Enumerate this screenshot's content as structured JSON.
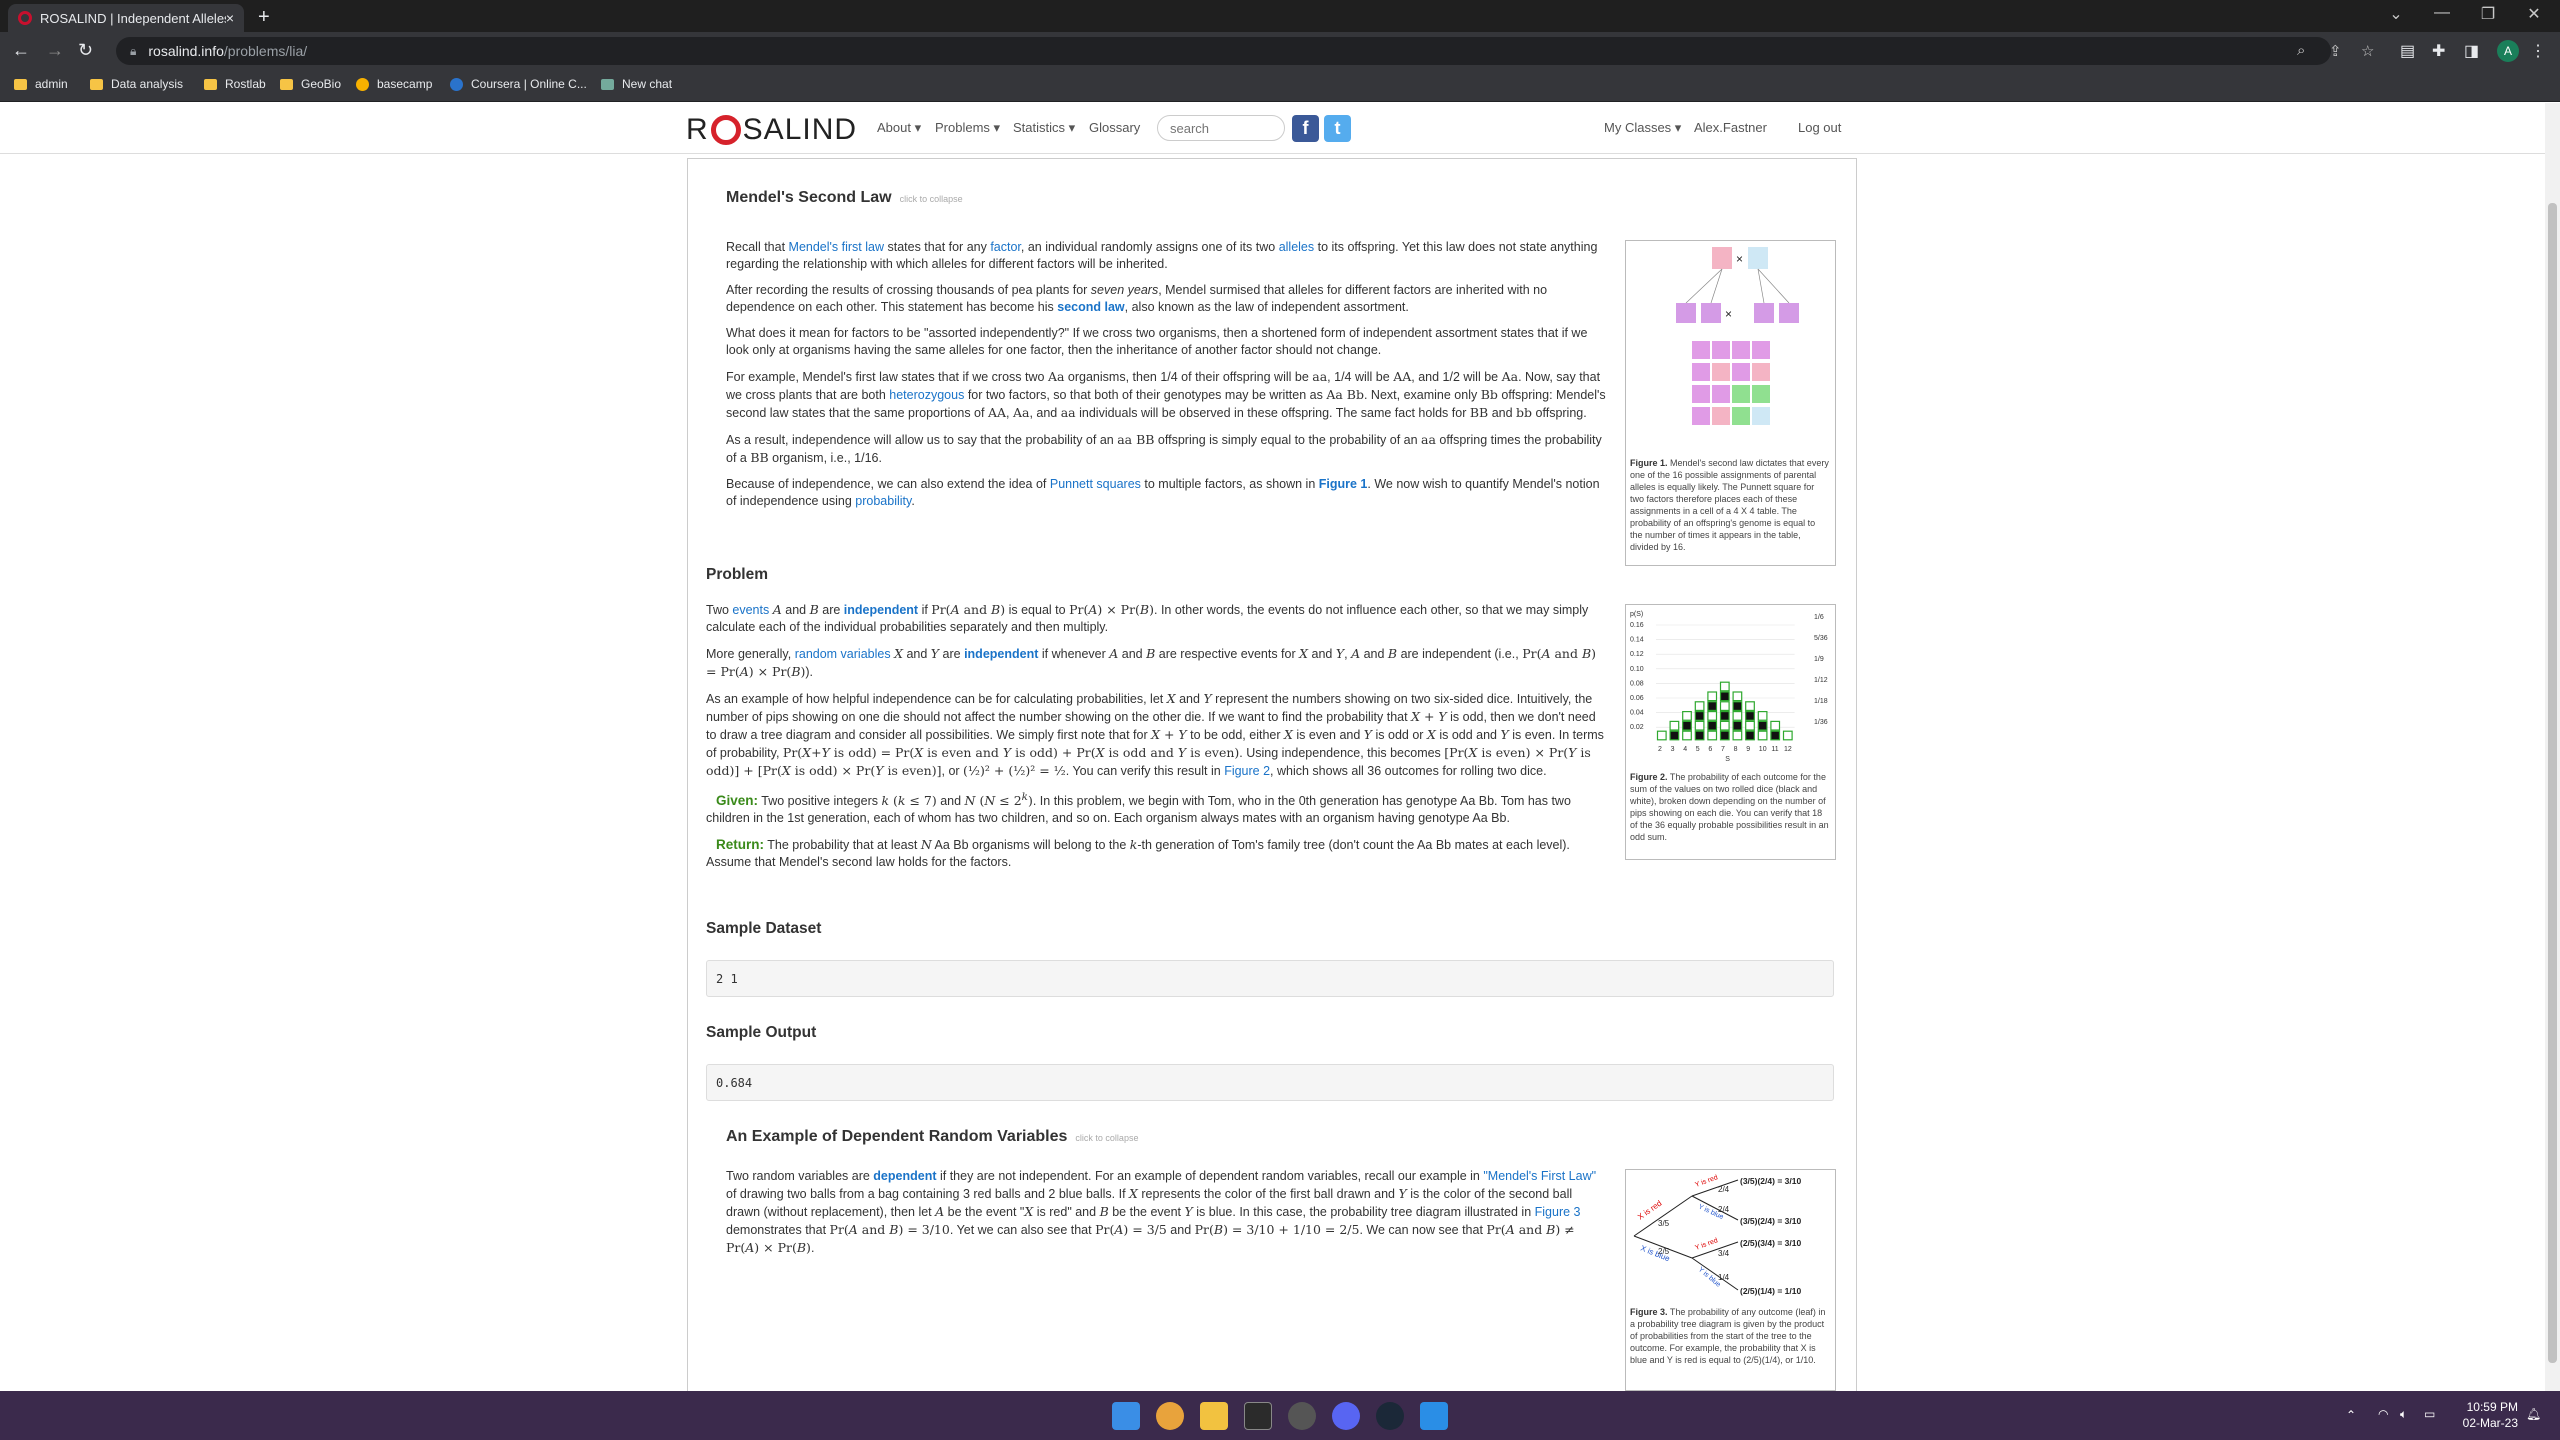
{
  "browser": {
    "tab_title": "ROSALIND | Independent Alleles",
    "tab_close": "×",
    "new_tab": "+",
    "url_host": "rosalind.info",
    "url_path": "/problems/lia/",
    "profile_initial": "A",
    "bookmarks": [
      "admin",
      "Data analysis",
      "Rostlab",
      "GeoBio",
      "basecamp",
      "Coursera | Online C...",
      "New chat"
    ]
  },
  "site": {
    "logo_left": "R",
    "logo_right": "SALIND",
    "nav": [
      "About",
      "Problems",
      "Statistics",
      "Glossary"
    ],
    "search_placeholder": "search",
    "facebook": "f",
    "twitter": "t",
    "my_classes": "My Classes",
    "user": "Alex.Fastner",
    "logout": "Log out"
  },
  "mendel": {
    "title": "Mendel's Second Law",
    "collapse": "click to collapse",
    "p1_a": "Recall that ",
    "p1_link1": "Mendel's first law",
    "p1_b": " states that for any ",
    "p1_link2": "factor",
    "p1_c": ", an individual randomly assigns one of its two ",
    "p1_link3": "alleles",
    "p1_d": " to its offspring. Yet this law does not state anything regarding the relationship with which alleles for different factors will be inherited.",
    "p2_a": "After recording the results of crossing thousands of pea plants for ",
    "p2_em": "seven years",
    "p2_b": ", Mendel surmised that alleles for different factors are inherited with no dependence on each other. This statement has become his ",
    "p2_link": "second law",
    "p2_c": ", also known as the law of independent assortment.",
    "p3": "What does it mean for factors to be \"assorted independently?\" If we cross two organisms, then a shortened form of independent assortment states that if we look only at organisms having the same alleles for one factor, then the inheritance of another factor should not change.",
    "p4_a": "For example, Mendel's first law states that if we cross two ",
    "p4_b": " organisms, then 1/4 of their offspring will be ",
    "p4_c": ", 1/4 will be ",
    "p4_d": ", and 1/2 will be ",
    "p4_e": ". Now, say that we cross plants that are both ",
    "p4_link": "heterozygous",
    "p4_f": " for two factors, so that both of their genotypes may be written as ",
    "p4_g": ". Next, examine only ",
    "p4_h": " offspring: Mendel's second law states that the same proportions of ",
    "p4_i": " individuals will be observed in these offspring. The same fact holds for ",
    "p4_j": " and ",
    "p4_k": " offspring.",
    "p5_a": "As a result, independence will allow us to say that the probability of an ",
    "p5_b": " offspring is simply equal to the probability of an ",
    "p5_c": " offspring times the probability of a ",
    "p5_d": " organism, i.e., 1/16.",
    "p6_a": "Because of independence, we can also extend the idea of ",
    "p6_link1": "Punnett squares",
    "p6_b": " to multiple factors, as shown in ",
    "p6_link2": "Figure 1",
    "p6_c": ". We now wish to quantify Mendel's notion of independence using ",
    "p6_link3": "probability",
    "p6_d": ".",
    "fig1_label": "Figure 1.",
    "fig1_caption": " Mendel's second law dictates that every one of the 16 possible assignments of parental alleles is equally likely. The Punnett square for two factors therefore places each of these assignments in a cell of a 4 X 4 table. The probability of an offspring's genome is equal to the number of times it appears in the table, divided by 16."
  },
  "problem": {
    "title": "Problem",
    "p1_a": "Two ",
    "p1_link1": "events",
    "p1_b": " are ",
    "p1_link2": "independent",
    "p1_c": " if ",
    "p1_d": " is equal to ",
    "p1_e": ". In other words, the events do not influence each other, so that we may simply calculate each of the individual probabilities separately and then multiply.",
    "p2_a": "More generally, ",
    "p2_link1": "random variables",
    "p2_b": " are ",
    "p2_link2": "independent",
    "p2_c": " if whenever ",
    "p2_d": " are respective events for ",
    "p2_e": " are independent (i.e., ",
    "p2_f": ").",
    "p3_a": "As an example of how helpful independence can be for calculating probabilities, let ",
    "p3_b": " represent the numbers showing on two six-sided dice. Intuitively, the number of pips showing on one die should not affect the number showing on the other die. If we want to find the probability that ",
    "p3_c": " is odd, then we don't need to draw a tree diagram and consider all possibilities. We simply first note that for ",
    "p3_d": " to be odd, either ",
    "p3_e": " is even and ",
    "p3_f": " is odd or ",
    "p3_g": " is odd and ",
    "p3_h": " is even. In terms of probability, ",
    "p3_i": ". Using independence, this becomes ",
    "p3_j": ", or ",
    "p3_k": ". You can verify this result in ",
    "p3_link": "Figure 2",
    "p3_l": ", which shows all 36 outcomes for rolling two dice.",
    "given_label": "Given:",
    "given_a": " Two positive integers ",
    "given_b": " and ",
    "given_c": ". In this problem, we begin with Tom, who in the 0th generation has genotype Aa Bb. Tom has two children in the 1st generation, each of whom has two children, and so on. Each organism always mates with an organism having genotype Aa Bb.",
    "return_label": "Return:",
    "return_a": " The probability that at least ",
    "return_b": " Aa Bb organisms will belong to the ",
    "return_c": "-th generation of Tom's family tree (don't count the Aa Bb mates at each level). Assume that Mendel's second law holds for the factors.",
    "fig2_label": "Figure 2.",
    "fig2_caption": " The probability of each outcome for the sum of the values on two rolled dice (black and white), broken down depending on the number of pips showing on each die. You can verify that 18 of the 36 equally probable possibilities result in an odd sum."
  },
  "sample": {
    "dataset_title": "Sample Dataset",
    "dataset": "2 1",
    "output_title": "Sample Output",
    "output": "0.684"
  },
  "dependent": {
    "title": "An Example of Dependent Random Variables",
    "collapse": "click to collapse",
    "p_a": "Two random variables are ",
    "p_link1": "dependent",
    "p_b": " if they are not independent. For an example of dependent random variables, recall our example in ",
    "p_link2": "\"Mendel's First Law\"",
    "p_c": " of drawing two balls from a bag containing 3 red balls and 2 blue balls. If ",
    "p_d": " represents the color of the first ball drawn and ",
    "p_e": " is the color of the second ball drawn (without replacement), then let ",
    "p_f": " be the event \"",
    "p_g": " is red\" and ",
    "p_h": " be the event ",
    "p_i": " is blue. In this case, the probability tree diagram illustrated in ",
    "p_link3": "Figure 3",
    "p_j": " demonstrates that ",
    "p_k": ". Yet we can also see that ",
    "p_l": " and ",
    "p_m": ". We can now see that ",
    "p_n": ".",
    "fig3_label": "Figure 3.",
    "fig3_caption": " The probability of any outcome (leaf) in a probability tree diagram is given by the product of probabilities from the start of the tree to the outcome. For example, the probability that X is blue and Y is red is equal to (2/5)(1/4), or 1/10.",
    "tree_leaves": [
      "(3/5)(2/4) = 3/10",
      "(3/5)(2/4) = 3/10",
      "(2/5)(3/4) = 3/10",
      "(2/5)(1/4) = 1/10"
    ],
    "tree_branches": [
      "X is red",
      "X is blue",
      "Y is red",
      "Y is blue",
      "Y is red",
      "Y is blue"
    ],
    "tree_probs": [
      "3/5",
      "2/5",
      "2/4",
      "2/4",
      "3/4",
      "1/4"
    ]
  },
  "fig2_chart": {
    "y_label": "p(S)",
    "y_ticks": [
      "0.16",
      "0.14",
      "0.12",
      "0.10",
      "0.08",
      "0.06",
      "0.04",
      "0.02"
    ],
    "x_ticks": [
      "2",
      "3",
      "4",
      "5",
      "6",
      "7",
      "8",
      "9",
      "10",
      "11",
      "12"
    ],
    "x_label": "S",
    "counts": [
      1,
      2,
      3,
      4,
      5,
      6,
      5,
      4,
      3,
      2,
      1
    ],
    "right_ticks": [
      "1/6",
      "5/36",
      "1/9",
      "1/12",
      "1/18",
      "1/36"
    ]
  },
  "taskbar": {
    "time": "10:59 PM",
    "date": "02-Mar-23"
  }
}
